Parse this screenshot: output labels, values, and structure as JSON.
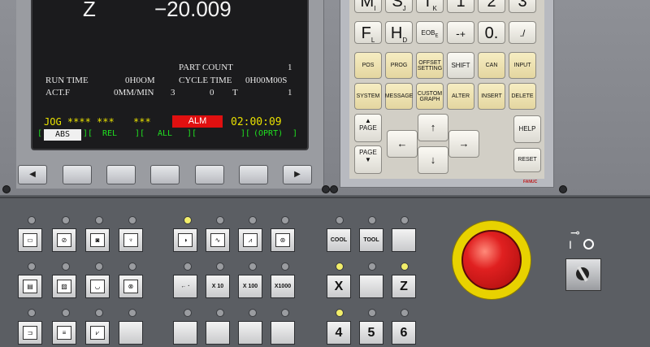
{
  "screen": {
    "axis_label": "Z",
    "axis_value": "−20.009",
    "part_count_label": "PART COUNT",
    "part_count_value": "1",
    "run_time_label": "RUN TIME",
    "run_time_value": "0H0OM",
    "cycle_time_label": "CYCLE TIME",
    "cycle_time_value": "0H00M00S",
    "actf_label": "ACT.F",
    "actf_value": "0MM/MIN",
    "actf_s": "3",
    "actf_n": "0",
    "actf_t_label": "T",
    "actf_t_value": "1",
    "mode": "JOG **** ***",
    "mode_stars": "***",
    "alarm": "ALM",
    "clock": "02:00:09",
    "softkeys": [
      "ABS",
      "REL",
      "ALL",
      "",
      "(OPRT)"
    ],
    "colors": {
      "alarm_bg": "#e01010",
      "mode_text": "#e8e000",
      "softkey_text": "#20e020"
    }
  },
  "keypad": {
    "row1": [
      "M",
      "S",
      "T",
      "1",
      "2",
      "3"
    ],
    "row1_sub": [
      "I",
      "J",
      "K",
      "",
      "",
      ""
    ],
    "row2": [
      "F",
      "H",
      "EOB",
      "-",
      "0",
      "/"
    ],
    "row2_sub": [
      "L",
      "D",
      "E",
      "+",
      ".",
      "."
    ],
    "fn_row1": [
      "POS",
      "PROG",
      "OFFSET SETTING",
      "SHIFT",
      "CAN",
      "INPUT"
    ],
    "fn_row2": [
      "SYSTEM",
      "MESSAGE",
      "CUSTOM GRAPH",
      "ALTER",
      "INSERT",
      "DELETE"
    ],
    "page_up": "PAGE",
    "page_down": "PAGE",
    "help": "HELP",
    "reset": "RESET",
    "brand": "FANUC"
  },
  "lower": {
    "group3_row1": [
      "COOL",
      "TOOL",
      ""
    ],
    "group3_row2": [
      "X",
      "",
      "Z"
    ],
    "group3_row3": [
      "4",
      "5",
      "6"
    ],
    "group2_row2": [
      "←  ·",
      "X 10",
      "X 100",
      "X1000"
    ],
    "key_switch_labels": [
      "I",
      "O"
    ],
    "colors": {
      "estop": "#d81414",
      "estop_ring": "#e8d200",
      "led_on": "#f2ee6a"
    }
  }
}
